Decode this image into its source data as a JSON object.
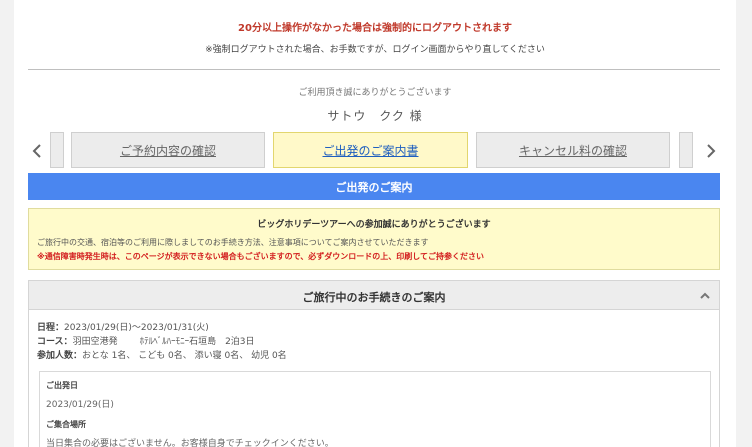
{
  "logout_warning": "20分以上操作がなかった場合は強制的にログアウトされます",
  "logout_note": "※強制ログアウトされた場合、お手数ですが、ログイン画面からやり直してください",
  "thanks_line": "ご利用頂き誠にありがとうございます",
  "customer_name": "サトウ　クク 様",
  "nav": {
    "left_arrow_icon": "chevron-left-icon",
    "right_arrow_icon": "chevron-right-icon",
    "tabs": [
      {
        "label": "ご予約内容の確認",
        "active": false
      },
      {
        "label": "ご出発のご案内書",
        "active": true
      },
      {
        "label": "キャンセル料の確認",
        "active": false
      }
    ]
  },
  "section_title": "ご出発のご案内",
  "notice": {
    "title": "ビッグホリデーツアーへの参加誠にありがとうございます",
    "body": "ご旅行中の交通、宿泊等のご利用に際しましてのお手続き方法、注意事項についてご案内させていただきます",
    "alert": "※通信障害時発生時は、このページが表示できない場合もございますので、必ずダウンロードの上、印刷してご持参ください"
  },
  "procedures": {
    "title": "ご旅行中のお手続きのご案内",
    "toggle_icon": "chevron-up-icon",
    "date_label": "日程：",
    "date_value": "2023/01/29(日)～2023/01/31(火)",
    "course_label": "コース：",
    "course_departure": "羽田空港発",
    "course_name": "ﾎﾃﾙﾍﾞﾙﾊｰﾓﾆｰ石垣島　2泊3日",
    "pax_label": "参加人数：",
    "pax_value": "おとな 1名、 こども 0名、 添い寝 0名、 幼児 0名",
    "departure_date_label": "ご出発日",
    "departure_date_value": "2023/01/29(日)",
    "meeting_place_label": "ご集合場所",
    "meeting_place_value": "当日集合の必要はございません。お客様自身でチェックインください。"
  },
  "colors": {
    "warning_red": "#c0392b",
    "alert_red": "#d32020",
    "section_blue": "#4a86f0",
    "notice_yellow": "#fffbcb",
    "active_tab_yellow": "#fff9c9",
    "active_tab_text": "#1f5fbf"
  }
}
